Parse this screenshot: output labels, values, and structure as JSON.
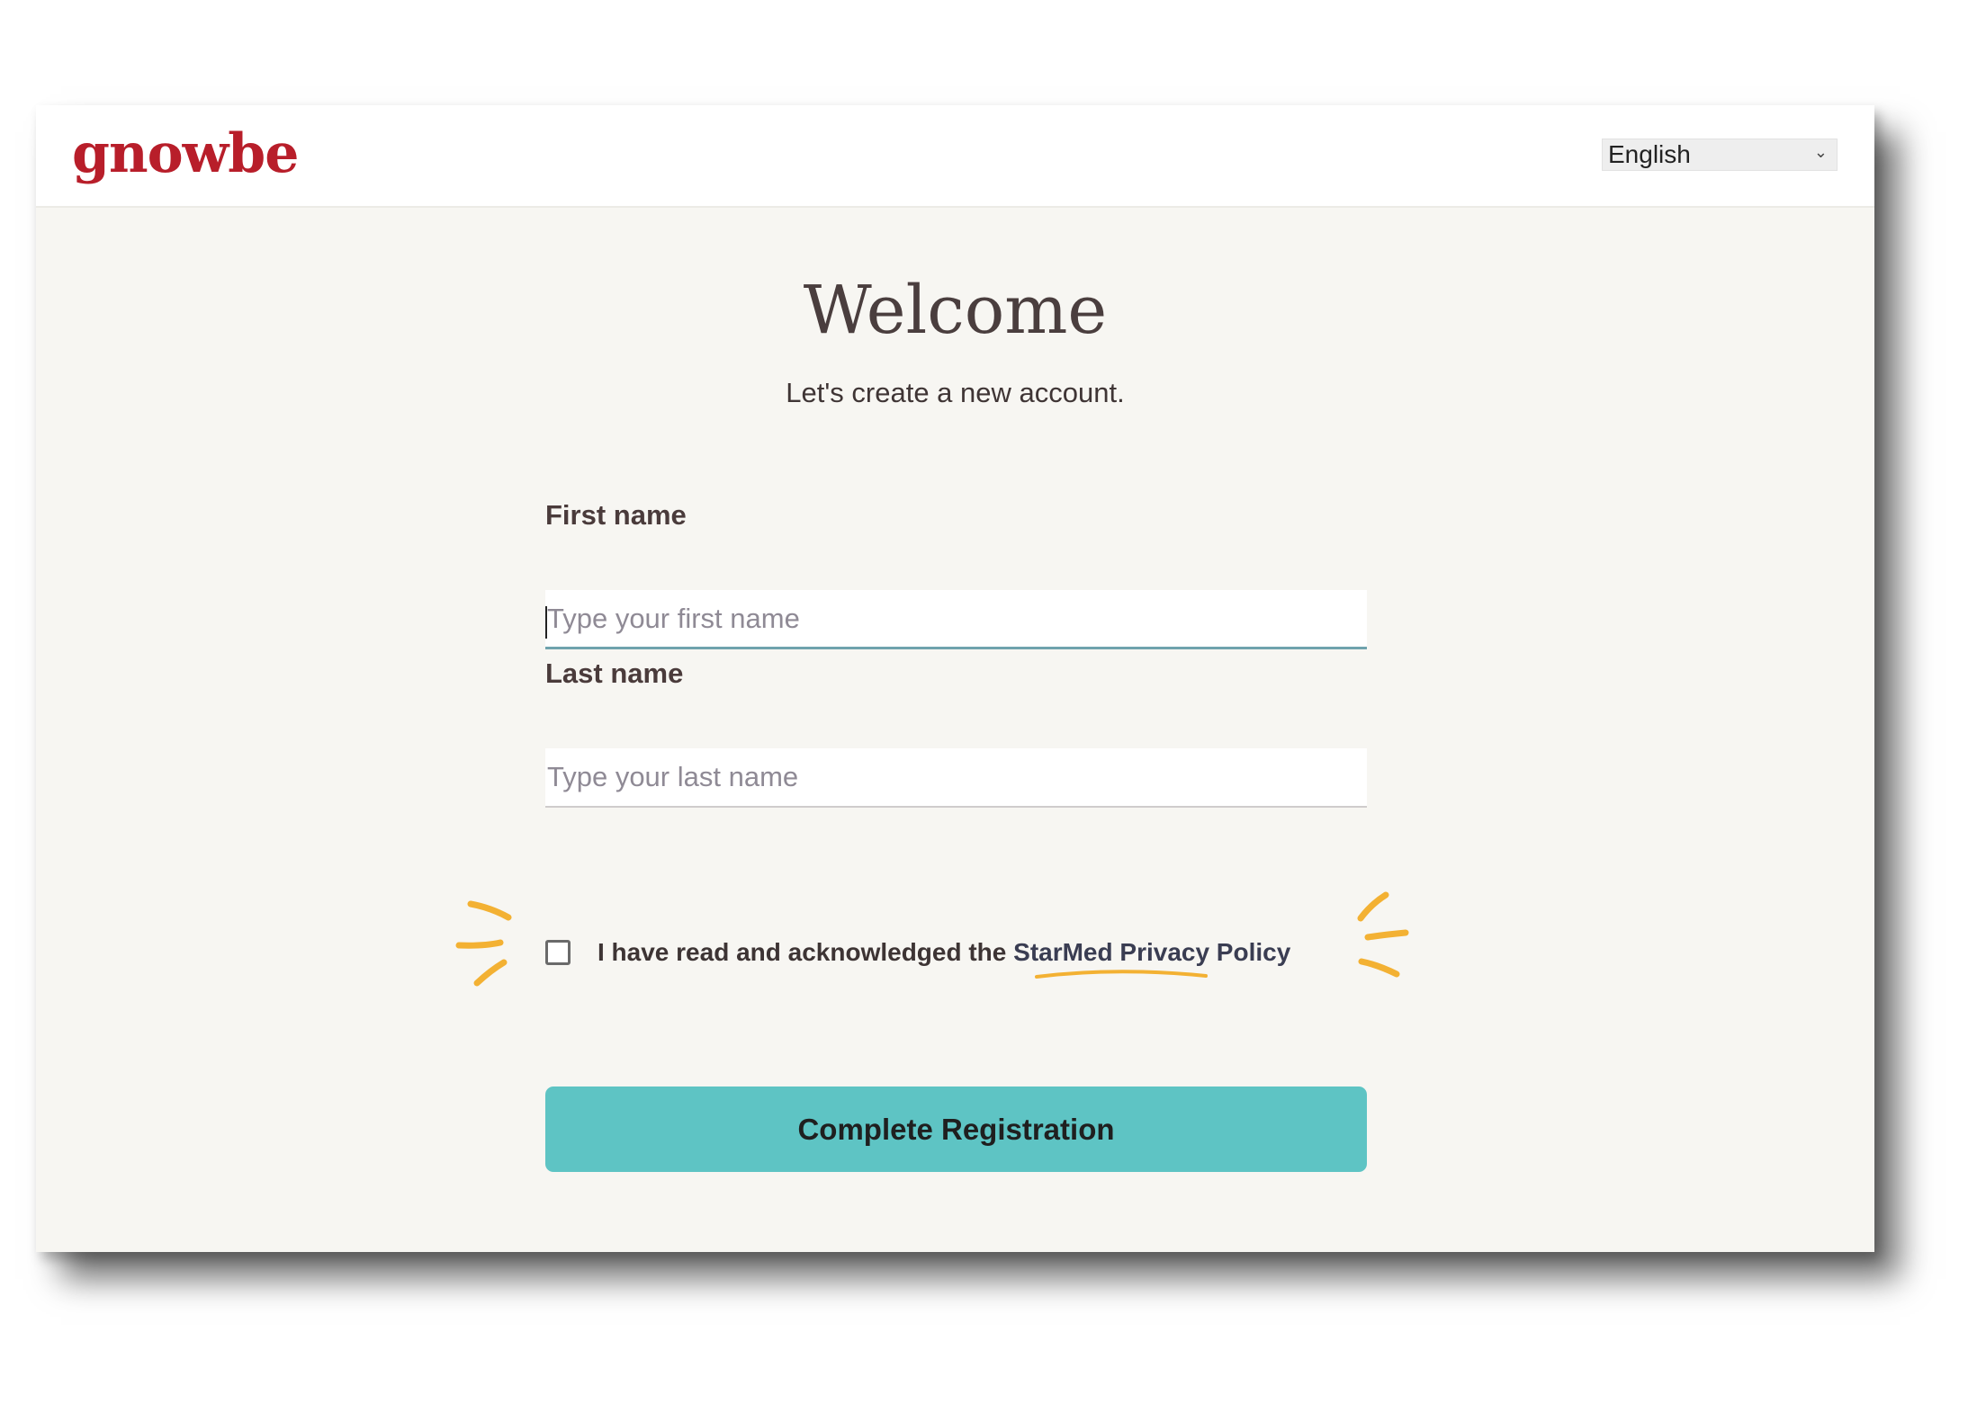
{
  "brand": {
    "logo_text": "gnowbe"
  },
  "header": {
    "language": {
      "selected": "English"
    }
  },
  "main": {
    "title": "Welcome",
    "subtitle": "Let's create a new account.",
    "form": {
      "first_name": {
        "label": "First name",
        "placeholder": "Type your first name",
        "value": ""
      },
      "last_name": {
        "label": "Last name",
        "placeholder": "Type your last name",
        "value": ""
      },
      "privacy": {
        "text": "I have read and acknowledged the ",
        "link_text": "StarMed Privacy Policy",
        "checked": false
      },
      "submit_label": "Complete Registration"
    }
  },
  "colors": {
    "brand": "#b81e2a",
    "accent": "#5ec4c4",
    "doodle": "#f3b133",
    "background": "#f7f6f2"
  },
  "icons": {
    "language_chevron": "chevron-down-icon",
    "checkbox": "checkbox-icon"
  }
}
